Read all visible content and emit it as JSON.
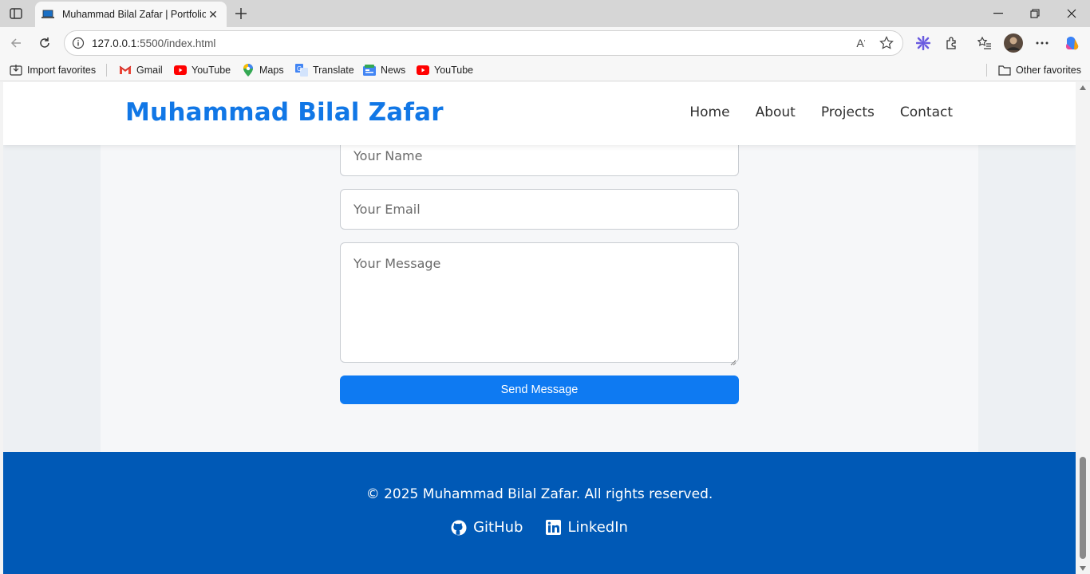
{
  "browser": {
    "tab_title": "Muhammad Bilal Zafar | Portfolio",
    "url_host": "127.0.0.1",
    "url_rest": ":5500/index.html",
    "bookmarks": [
      {
        "label": "Import favorites",
        "icon": "import-icon"
      },
      {
        "label": "Gmail",
        "icon": "gmail-icon"
      },
      {
        "label": "YouTube",
        "icon": "youtube-icon"
      },
      {
        "label": "Maps",
        "icon": "maps-icon"
      },
      {
        "label": "Translate",
        "icon": "translate-icon"
      },
      {
        "label": "News",
        "icon": "news-icon"
      },
      {
        "label": "YouTube",
        "icon": "youtube-icon"
      }
    ],
    "other_favorites": "Other favorites"
  },
  "site": {
    "logo": "Muhammad Bilal Zafar",
    "nav": [
      "Home",
      "About",
      "Projects",
      "Contact"
    ],
    "brand_color": "#1177e6"
  },
  "contact_form": {
    "name_placeholder": "Your Name",
    "email_placeholder": "Your Email",
    "message_placeholder": "Your Message",
    "submit_label": "Send Message",
    "button_color": "#0e7af2"
  },
  "footer": {
    "copyright": "© 2025 Muhammad Bilal Zafar. All rights reserved.",
    "links": [
      {
        "label": "GitHub",
        "icon": "github-icon"
      },
      {
        "label": "LinkedIn",
        "icon": "linkedin-icon"
      }
    ],
    "background": "#0059b6"
  }
}
